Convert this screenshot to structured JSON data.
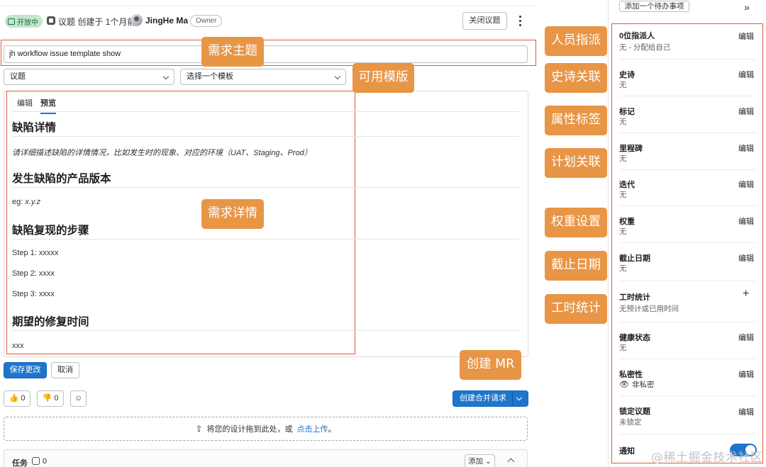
{
  "header": {
    "status": "开放中",
    "meta": "议题 创建于 1个月前",
    "author": "JingHe Ma",
    "role": "Owner",
    "close_label": "关闭议题"
  },
  "form": {
    "title_value": "jh workflow issue template show",
    "type_select": "议题",
    "template_select": "选择一个模板"
  },
  "editor": {
    "tabs": [
      "编辑",
      "预览"
    ],
    "h1": "缺陷详情",
    "p1": "请详细描述缺陷的详情情况，比如发生时的现象、对应的环境（UAT、Staging、Prod）",
    "h2": "发生缺陷的产品版本",
    "p2_prefix": "eg: ",
    "p2_value": "x.y.z",
    "h3": "缺陷复现的步骤",
    "steps": [
      "Step 1: xxxxx",
      "Step 2: xxxx",
      "Step 3: xxxx"
    ],
    "h4": "期望的修复时间",
    "p4": "xxx"
  },
  "actions": {
    "save": "保存更改",
    "cancel": "取消",
    "thumbs_up_count": "0",
    "thumbs_down_count": "0",
    "create_mr": "创建合并请求"
  },
  "dropzone": {
    "text": "将您的设计拖到此处，或",
    "link": "点击上传",
    "suffix": "。"
  },
  "tasks": {
    "label": "任务",
    "count": "0",
    "add": "添加"
  },
  "annotations": {
    "title_tag": "需求主题",
    "template_tag": "可用模版",
    "detail_tag": "需求详情",
    "mr_tag": "创建 MR",
    "assignee_tag": "人员指派",
    "epic_tag": "史诗关联",
    "label_tag": "属性标签",
    "milestone_tag": "计划关联",
    "weight_tag": "权重设置",
    "due_tag": "截止日期",
    "time_tag": "工时统计"
  },
  "sidebar": {
    "todo": "添加一个待办事项",
    "edit": "编辑",
    "assignee_title": "0位指派人",
    "assignee_value": "无 - 分配给自己",
    "epic_title": "史诗",
    "epic_value": "无",
    "labels_title": "标记",
    "labels_value": "无",
    "milestone_title": "里程碑",
    "milestone_value": "无",
    "iteration_title": "迭代",
    "iteration_value": "无",
    "weight_title": "权重",
    "weight_value": "无",
    "due_title": "截止日期",
    "due_value": "无",
    "time_title": "工时统计",
    "time_value": "无预计或已用时间",
    "health_title": "健康状态",
    "health_value": "无",
    "confidential_title": "私密性",
    "confidential_value": "非私密",
    "lock_title": "锁定议题",
    "lock_value": "未锁定",
    "notify_title": "通知"
  },
  "watermark": "@稀土掘金技术社区",
  "colors": {
    "accent": "#1f75cb",
    "annotation": "#e89545",
    "highlight_border": "#e1583e",
    "status_bg": "#c3e6cd"
  }
}
